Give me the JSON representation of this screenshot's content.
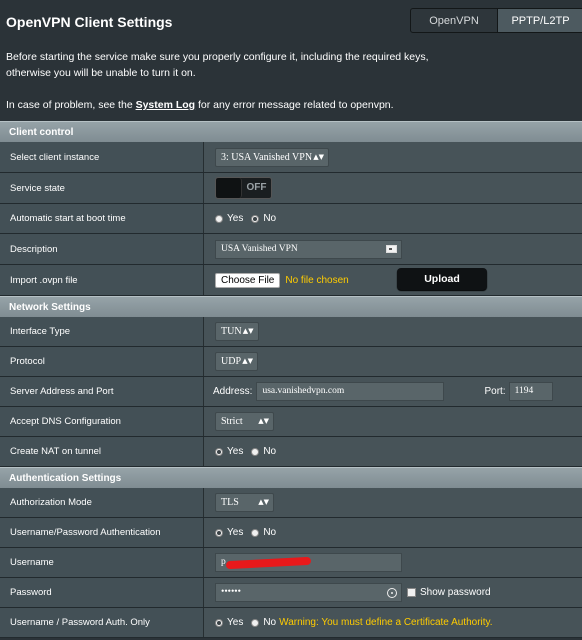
{
  "header": {
    "title": "OpenVPN Client Settings",
    "tabs": [
      "OpenVPN",
      "PPTP/L2TP"
    ]
  },
  "intro": {
    "line1": "Before starting the service make sure you properly configure it, including the required keys,",
    "line2": "otherwise you will be unable to turn it on.",
    "line3_prefix": "In case of problem, see the ",
    "line3_link": "System Log",
    "line3_suffix": " for any error message related to openvpn."
  },
  "client_control": {
    "section_title": "Client control",
    "select_instance_label": "Select client instance",
    "select_instance_value": "3: USA Vanished VPN",
    "service_state_label": "Service state",
    "service_state_value": "OFF",
    "autostart_label": "Automatic start at boot time",
    "autostart_yes": "Yes",
    "autostart_no": "No",
    "description_label": "Description",
    "description_value": "USA Vanished VPN",
    "import_label": "Import .ovpn file",
    "choose_file": "Choose File",
    "no_file": "No file chosen",
    "upload": "Upload"
  },
  "network": {
    "section_title": "Network Settings",
    "interface_label": "Interface Type",
    "interface_value": "TUN",
    "protocol_label": "Protocol",
    "protocol_value": "UDP",
    "server_label": "Server Address and Port",
    "address_label": "Address:",
    "address_value": "usa.vanishedvpn.com",
    "port_label": "Port:",
    "port_value": "1194",
    "dns_label": "Accept DNS Configuration",
    "dns_value": "Strict",
    "nat_label": "Create NAT on tunnel",
    "nat_yes": "Yes",
    "nat_no": "No"
  },
  "auth": {
    "section_title": "Authentication Settings",
    "mode_label": "Authorization Mode",
    "mode_value": "TLS",
    "userpass_label": "Username/Password Authentication",
    "userpass_yes": "Yes",
    "userpass_no": "No",
    "username_label": "Username",
    "username_value": "p                  .com",
    "password_label": "Password",
    "password_value": "••••••",
    "show_password": "Show password",
    "authonly_label": "Username / Password Auth. Only",
    "authonly_yes": "Yes",
    "authonly_no": "No",
    "warning": "Warning: You must define a Certificate Authority."
  }
}
